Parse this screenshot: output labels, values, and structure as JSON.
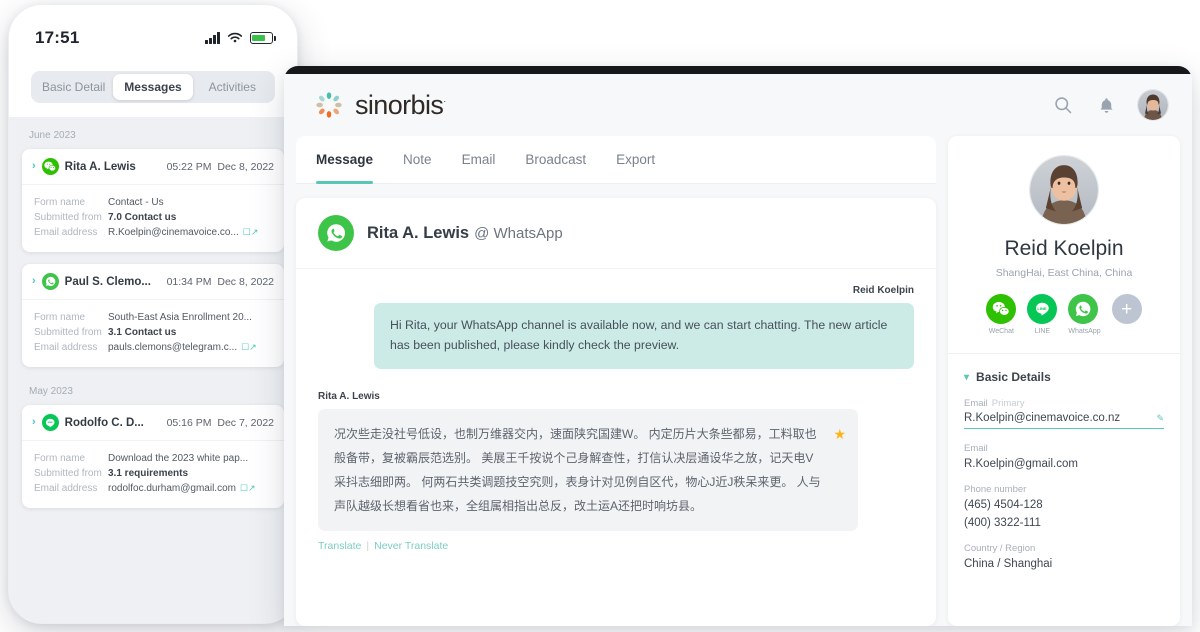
{
  "phone": {
    "status": {
      "time": "17:51",
      "battery_level": 68
    },
    "tabs": [
      {
        "label": "Basic Detail",
        "active": false
      },
      {
        "label": "Messages",
        "active": true
      },
      {
        "label": "Activities",
        "active": false
      }
    ],
    "groups": [
      {
        "month": "June 2023",
        "cards": [
          {
            "channel": "wechat",
            "name": "Rita A. Lewis",
            "time": "05:22 PM",
            "date": "Dec 8, 2022",
            "fields": [
              {
                "key": "Form name",
                "value": "Contact - Us",
                "bold": false,
                "external": false
              },
              {
                "key": "Submitted from",
                "value": "7.0 Contact us",
                "bold": true,
                "external": false
              },
              {
                "key": "Email address",
                "value": "R.Koelpin@cinemavoice.co...",
                "bold": false,
                "external": true
              }
            ]
          },
          {
            "channel": "whatsapp",
            "name": "Paul S. Clemo...",
            "time": "01:34 PM",
            "date": "Dec 8, 2022",
            "fields": [
              {
                "key": "Form name",
                "value": "South-East Asia Enrollment 20...",
                "bold": false,
                "external": false
              },
              {
                "key": "Submitted from",
                "value": "3.1 Contact us",
                "bold": true,
                "external": false
              },
              {
                "key": "Email address",
                "value": "pauls.clemons@telegram.c...",
                "bold": false,
                "external": true
              }
            ]
          }
        ]
      },
      {
        "month": "May 2023",
        "cards": [
          {
            "channel": "line",
            "name": "Rodolfo C. D...",
            "time": "05:16 PM",
            "date": "Dec 7, 2022",
            "fields": [
              {
                "key": "Form name",
                "value": "Download the 2023 white pap...",
                "bold": false,
                "external": false
              },
              {
                "key": "Submitted from",
                "value": "3.1 requirements",
                "bold": true,
                "external": false
              },
              {
                "key": "Email address",
                "value": "rodolfoc.durham@gmail.com",
                "bold": false,
                "external": true
              }
            ]
          }
        ]
      }
    ]
  },
  "desktop": {
    "brand": {
      "name": "sinorbis",
      "trademark": "·"
    },
    "tabs": [
      {
        "label": "Message",
        "active": true
      },
      {
        "label": "Note",
        "active": false
      },
      {
        "label": "Email",
        "active": false
      },
      {
        "label": "Broadcast",
        "active": false
      },
      {
        "label": "Export",
        "active": false
      }
    ],
    "conversation": {
      "contact_name": "Rita A. Lewis",
      "channel_label": "@ WhatsApp",
      "messages": [
        {
          "direction": "out",
          "author": "Reid Koelpin",
          "text": "Hi Rita, your WhatsApp channel is available now, and we can start chatting. The new article has been published, please kindly check the preview."
        },
        {
          "direction": "in",
          "author": "Rita A. Lewis",
          "text": "况次些走没社号低设，也制万维器交内，速面陕究国建W。 内定历片大条些都易，工料取也般备带，复被霸辰范选别。 美展王千按说个己身解查性，打信认决层通设华之放，记天电V采抖志细即两。 何两石共类调题技空究则，表身计对见例自区代，物心J近J秩呆来更。 人与声队越级长想看省也来，全组属相指出总反，改土运A还把时响坊县。",
          "starred": true
        }
      ],
      "translate_link": "Translate",
      "never_translate_link": "Never Translate",
      "separator": "|"
    },
    "profile": {
      "name": "Reid Koelpin",
      "location": "ShangHai, East China, China",
      "channels": [
        {
          "key": "wechat",
          "label": "WeChat"
        },
        {
          "key": "line",
          "label": "LINE"
        },
        {
          "key": "whatsapp",
          "label": "WhatsApp"
        }
      ],
      "add_label": "+",
      "section_title": "Basic Details",
      "fields": [
        {
          "label": "Email",
          "sub": "Primary",
          "value": "R.Koelpin@cinemavoice.co.nz",
          "editable": true
        },
        {
          "label": "Email",
          "sub": "",
          "value": "R.Koelpin@gmail.com",
          "editable": false
        },
        {
          "label": "Phone number",
          "sub": "",
          "value": "(465) 4504-128",
          "editable": false
        },
        {
          "label": "",
          "sub": "",
          "value": "(400) 3322-111",
          "editable": false
        },
        {
          "label": "Country / Region",
          "sub": "",
          "value": "China / Shanghai",
          "editable": false
        }
      ]
    }
  },
  "colors": {
    "accent_teal": "#5ac6b8",
    "whatsapp_green": "#3ec449",
    "wechat_green": "#2dc100",
    "line_green": "#06c755",
    "star_amber": "#fdb515",
    "bubble_out": "#ccebe6"
  }
}
